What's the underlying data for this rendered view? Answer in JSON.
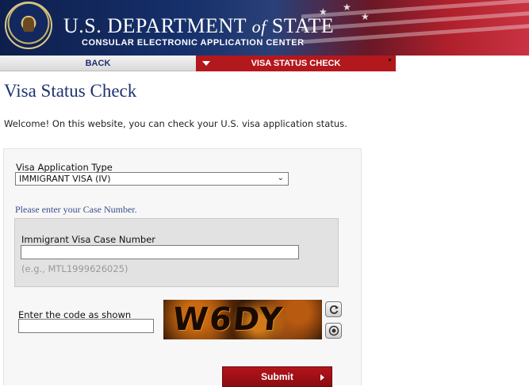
{
  "header": {
    "title_prefix": "U.S. DEPARTMENT ",
    "title_of": "of",
    "title_suffix": " STATE",
    "subtitle": "CONSULAR ELECTRONIC APPLICATION CENTER",
    "colors": {
      "navy": "#12285e",
      "red": "#b3181d"
    }
  },
  "nav": {
    "back_label": "BACK",
    "visa_label": "VISA STATUS CHECK"
  },
  "page": {
    "title": "Visa Status Check",
    "welcome": "Welcome! On this website, you can check your U.S. visa application status."
  },
  "form": {
    "visa_type_label": "Visa Application Type",
    "visa_type_value": "IMMIGRANT VISA (IV)",
    "case_prompt": "Please enter your Case Number.",
    "case_label": "Immigrant Visa Case Number",
    "case_value": "",
    "case_hint": "(e.g., MTL1999626025)",
    "code_label": "Enter the code as shown",
    "code_value": "",
    "captcha_text": "W6DY",
    "submit_label": "Submit",
    "icons": {
      "refresh": "refresh-icon",
      "audio": "audio-icon"
    }
  }
}
